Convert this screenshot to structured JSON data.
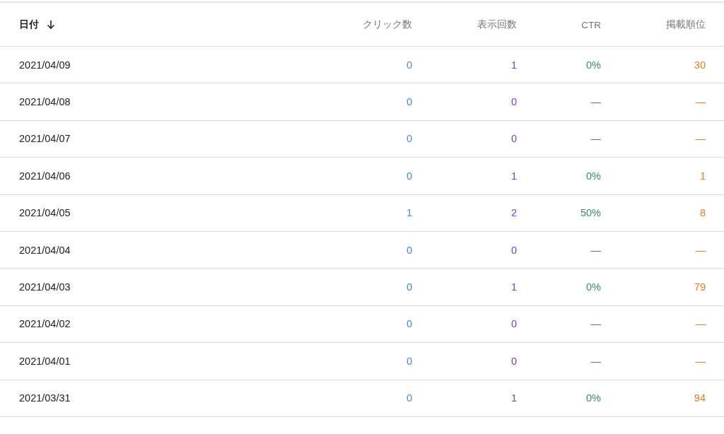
{
  "table": {
    "columns": [
      {
        "label": "日付",
        "color": "#212121",
        "sorted": true
      },
      {
        "label": "クリック数",
        "color": "#4f86d4",
        "sorted": false
      },
      {
        "label": "表示回数",
        "color": "#7b3fb5",
        "sorted": false
      },
      {
        "label": "CTR",
        "color": "#3b8a6e",
        "sorted": false
      },
      {
        "label": "掲載順位",
        "color": "#e07a2e",
        "sorted": false
      }
    ],
    "rows": [
      [
        "2021/04/09",
        "0",
        "1",
        "0%",
        "30"
      ],
      [
        "2021/04/08",
        "0",
        "0",
        "—",
        "—"
      ],
      [
        "2021/04/07",
        "0",
        "0",
        "—",
        "—"
      ],
      [
        "2021/04/06",
        "0",
        "1",
        "0%",
        "1"
      ],
      [
        "2021/04/05",
        "1",
        "2",
        "50%",
        "8"
      ],
      [
        "2021/04/04",
        "0",
        "0",
        "—",
        "—"
      ],
      [
        "2021/04/03",
        "0",
        "1",
        "0%",
        "79"
      ],
      [
        "2021/04/02",
        "0",
        "0",
        "—",
        "—"
      ],
      [
        "2021/04/01",
        "0",
        "0",
        "—",
        "—"
      ],
      [
        "2021/03/31",
        "0",
        "1",
        "0%",
        "94"
      ]
    ]
  }
}
